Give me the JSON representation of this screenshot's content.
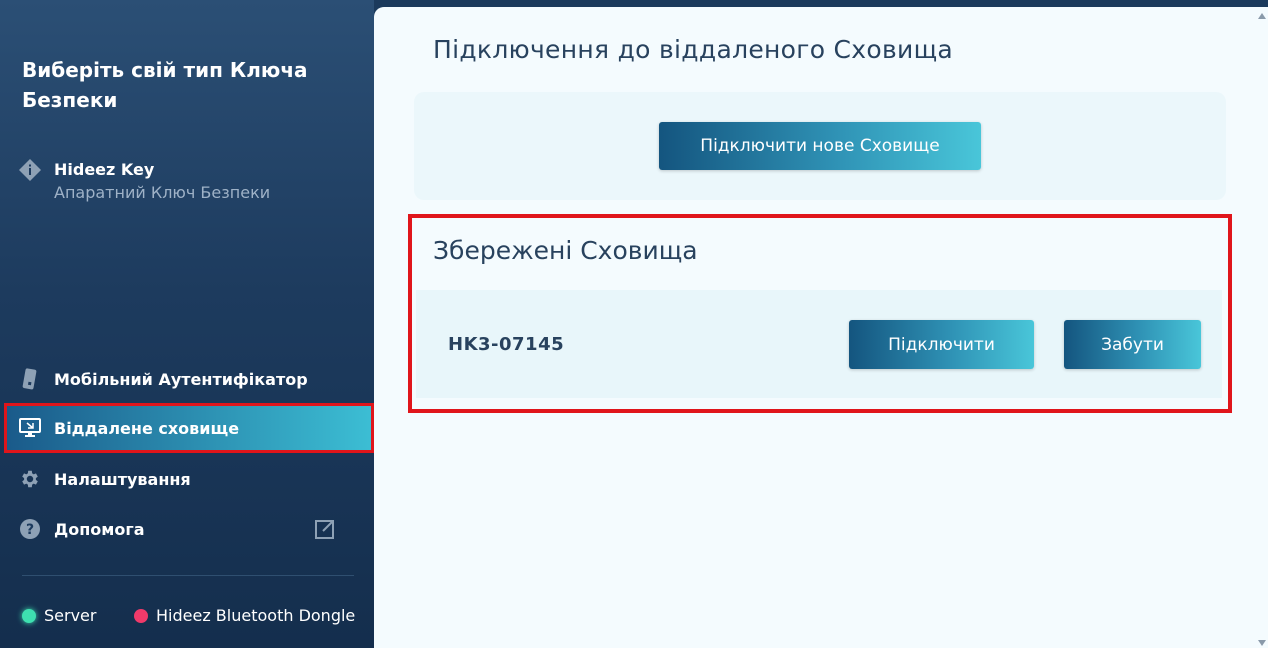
{
  "sidebar": {
    "title": "Виберіть свій тип Ключа Безпеки",
    "key": {
      "name": "Hideez Key",
      "subtitle": "Апаратний Ключ Безпеки"
    },
    "nav": [
      {
        "label": "Мобільний Аутентифікатор",
        "icon": "phone-icon"
      },
      {
        "label": "Віддалене сховище",
        "icon": "monitor-icon",
        "active": true
      },
      {
        "label": "Налаштування",
        "icon": "gear-icon"
      },
      {
        "label": "Допомога",
        "icon": "help-icon"
      }
    ],
    "status": [
      {
        "label": "Server",
        "color": "#3ee0b0"
      },
      {
        "label": "Hideez Bluetooth Dongle",
        "color": "#f03a6a"
      }
    ]
  },
  "main": {
    "title": "Підключення до віддаленого Сховища",
    "new_vault_button": "Підключити нове Сховище",
    "saved": {
      "title": "Збережені Сховища",
      "vaults": [
        {
          "name": "HK3-07145",
          "connect_label": "Підключити",
          "forget_label": "Забути"
        }
      ]
    }
  },
  "colors": {
    "highlight": "#e0151b",
    "accent_start": "#14557f",
    "accent_end": "#49c6d9"
  }
}
